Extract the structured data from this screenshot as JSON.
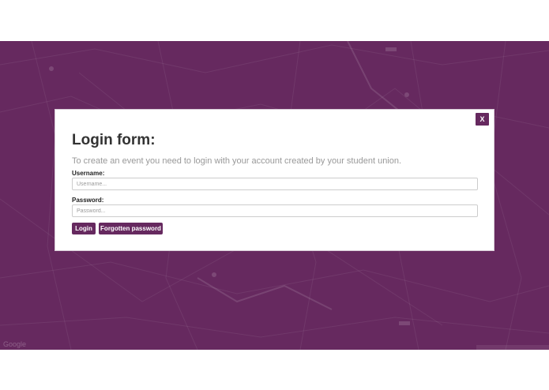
{
  "map": {
    "attribution": "Google",
    "background_color": "#66295f"
  },
  "modal": {
    "close_label": "X",
    "title": "Login form:",
    "description": "To create an event you need to login with your account created by your student union.",
    "username": {
      "label": "Username:",
      "placeholder": "Username...",
      "value": ""
    },
    "password": {
      "label": "Password:",
      "placeholder": "Password...",
      "value": ""
    },
    "buttons": {
      "login": "Login",
      "forgot": "Forgotten password"
    }
  },
  "colors": {
    "accent": "#66295f",
    "title_text": "#333333",
    "description_text": "#999999"
  }
}
